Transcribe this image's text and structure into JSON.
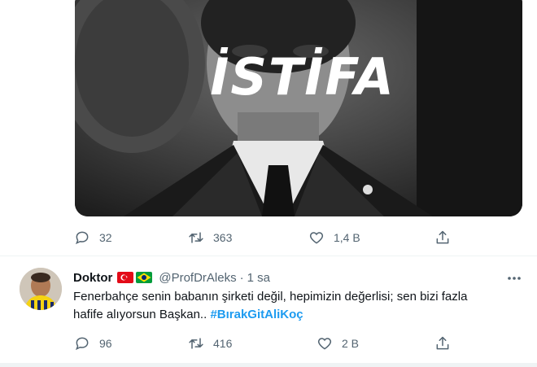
{
  "tweet1": {
    "media_caption": "İSTİFA",
    "actions": {
      "reply": "32",
      "retweet": "363",
      "like": "1,4 B"
    }
  },
  "tweet2": {
    "author_name": "Doktor",
    "flags": [
      "turkey-flag",
      "brazil-flag"
    ],
    "handle": "@ProfDrAleks",
    "separator": "·",
    "time": "1 sa",
    "text_line1": "Fenerbahçe senin babanın şirketi değil, hepimizin değerlisi; sen bizi fazla",
    "text_line2": "hafife alıyorsun Başkan..",
    "hashtag": "#BırakGitAliKoç",
    "actions": {
      "reply": "96",
      "retweet": "416",
      "like": "2 B"
    }
  },
  "colors": {
    "accent": "#1d9bf0",
    "muted": "#536471",
    "text": "#0f1419"
  },
  "icons": [
    "reply-icon",
    "retweet-icon",
    "like-icon",
    "share-icon",
    "more-icon"
  ]
}
